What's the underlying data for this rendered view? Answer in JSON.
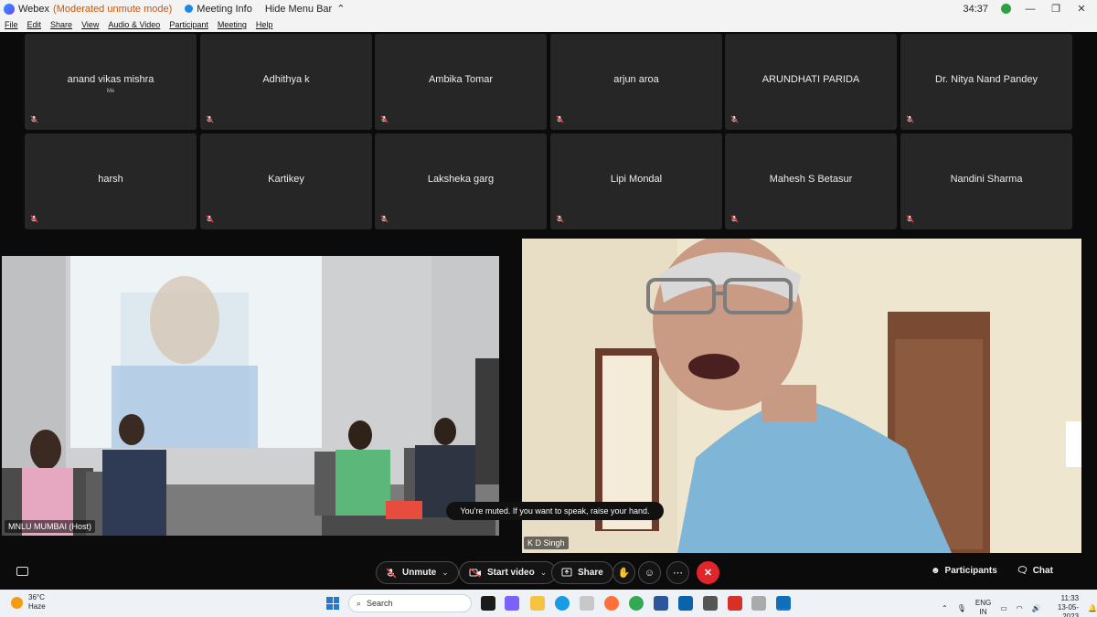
{
  "titlebar": {
    "app_name": "Webex",
    "mode": "(Moderated unmute mode)",
    "meeting_info": "Meeting Info",
    "hide_menu": "Hide Menu Bar",
    "timer": "34:37"
  },
  "menu": [
    "File",
    "Edit",
    "Share",
    "View",
    "Audio & Video",
    "Participant",
    "Meeting",
    "Help"
  ],
  "participants": [
    {
      "name": "anand vikas mishra",
      "sub": "Me"
    },
    {
      "name": "Adhithya k",
      "sub": ""
    },
    {
      "name": "Ambika Tomar",
      "sub": ""
    },
    {
      "name": "arjun aroa",
      "sub": ""
    },
    {
      "name": "ARUNDHATI PARIDA",
      "sub": ""
    },
    {
      "name": "Dr. Nitya Nand Pandey",
      "sub": ""
    },
    {
      "name": "harsh",
      "sub": ""
    },
    {
      "name": "Kartikey",
      "sub": ""
    },
    {
      "name": "Laksheka garg",
      "sub": ""
    },
    {
      "name": "Lipi Mondal",
      "sub": ""
    },
    {
      "name": "Mahesh S Betasur",
      "sub": ""
    },
    {
      "name": "Nandini Sharma",
      "sub": ""
    }
  ],
  "videos": {
    "left_label": "MNLU MUMBAI (Host)",
    "right_label": "K D Singh"
  },
  "toast": "You're muted. If you want to speak, raise your hand.",
  "controls": {
    "unmute": "Unmute",
    "start_video": "Start video",
    "share": "Share",
    "participants": "Participants",
    "chat": "Chat"
  },
  "taskbar": {
    "temp": "36°C",
    "weather": "Haze",
    "search_placeholder": "Search",
    "lang1": "ENG",
    "lang2": "IN",
    "time": "11:33",
    "date": "13-05-2023"
  },
  "colors": {
    "tile_bg": "#262626",
    "end_red": "#e0252b",
    "mode_orange": "#d35400"
  }
}
